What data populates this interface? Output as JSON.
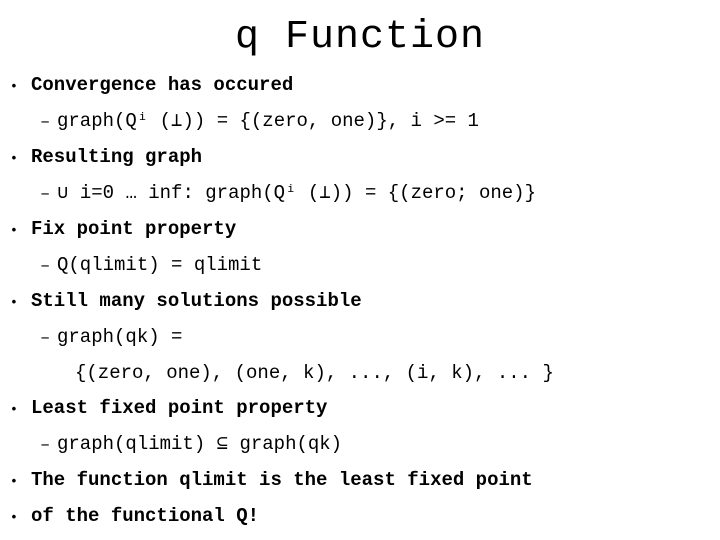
{
  "slide": {
    "title": "q Function",
    "bullet_glyph": "•",
    "dash_glyph": "–",
    "lines": [
      {
        "level": 1,
        "text": "Convergence has occured"
      },
      {
        "level": 2,
        "text": "graph(Qⁱ (⊥)) = {(zero, one)}, i >= 1"
      },
      {
        "level": 1,
        "text": "Resulting graph"
      },
      {
        "level": 2,
        "text": "∪ i=0 … inf: graph(Qⁱ (⊥)) = {(zero; one)}"
      },
      {
        "level": 1,
        "text": "Fix point property"
      },
      {
        "level": 2,
        "text": "Q(qlimit) = qlimit"
      },
      {
        "level": 1,
        "text": "Still many solutions possible"
      },
      {
        "level": 2,
        "text": "graph(qk) ="
      },
      {
        "level": 3,
        "text": "{(zero, one), (one, k), ..., (i, k), ... }"
      },
      {
        "level": 1,
        "text": "Least fixed point property"
      },
      {
        "level": 2,
        "text": "graph(qlimit) ⊆ graph(qk)"
      },
      {
        "level": 1,
        "text": "The function qlimit is the least fixed point"
      },
      {
        "level": 1,
        "text": "of the functional Q!"
      }
    ]
  },
  "colors": {
    "background": "#ffffff",
    "text": "#000000"
  }
}
